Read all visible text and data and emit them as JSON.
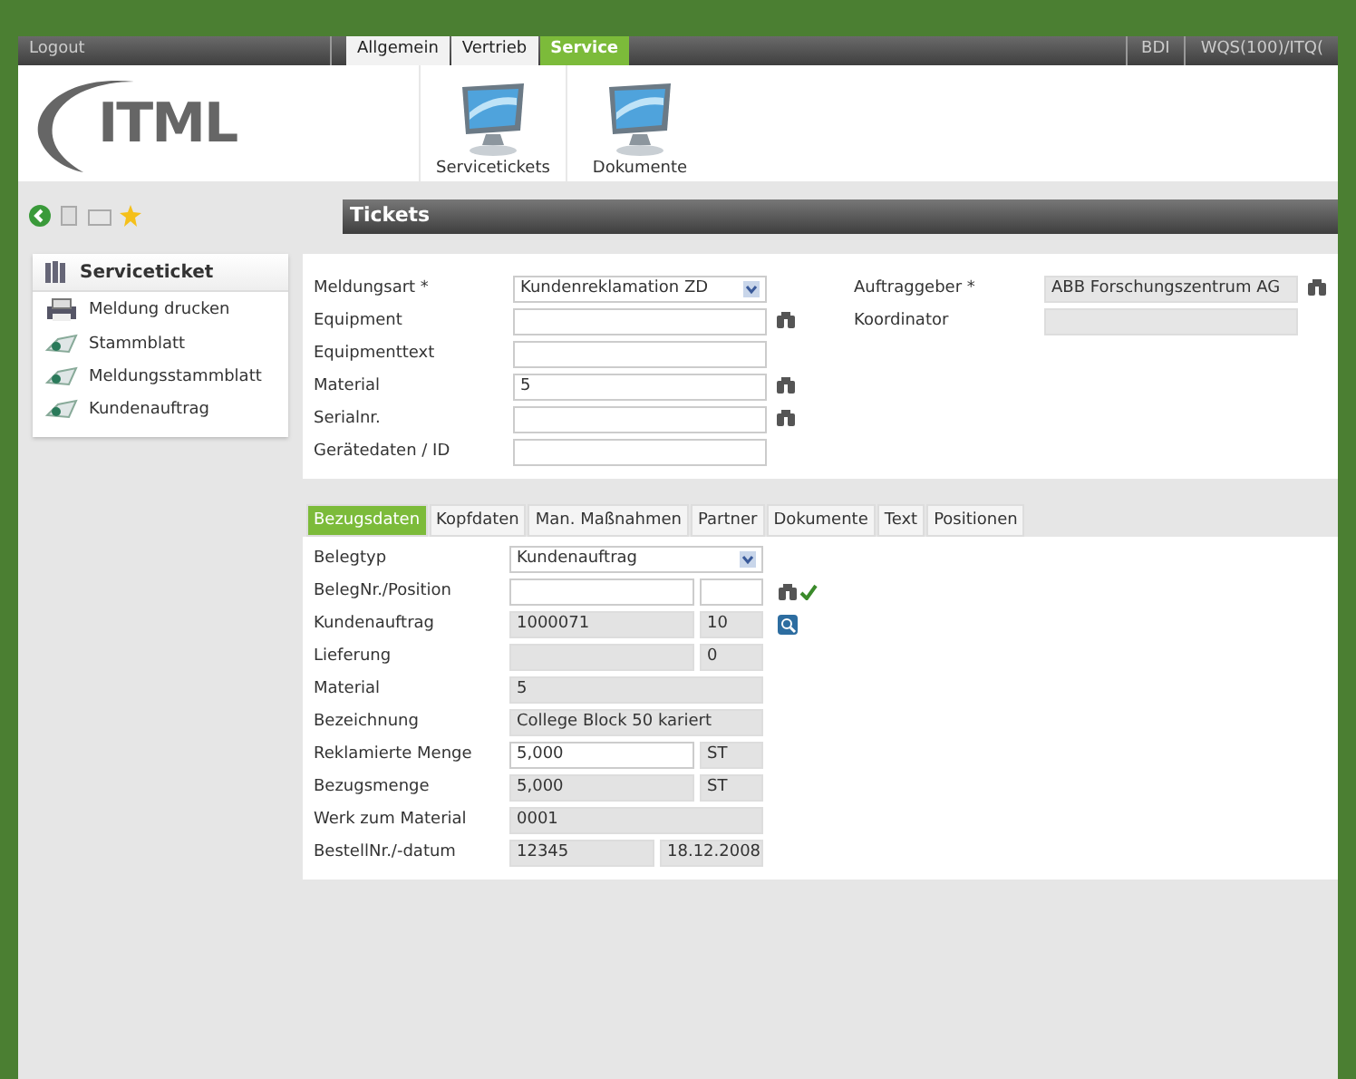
{
  "top_bar": {
    "logout": "Logout",
    "nav_tabs": [
      {
        "label": "Allgemein",
        "selected": false
      },
      {
        "label": "Vertrieb",
        "selected": false
      },
      {
        "label": "Service",
        "selected": true
      }
    ],
    "right_items": [
      "BDI",
      "WQS(100)/ITQ("
    ]
  },
  "logo": {
    "text": "ITML"
  },
  "launchers": [
    {
      "label": "Servicetickets"
    },
    {
      "label": "Dokumente"
    }
  ],
  "panel_title": "Tickets",
  "sidebar": {
    "title": "Serviceticket",
    "items": [
      {
        "label": "Meldung drucken",
        "kind": "print"
      },
      {
        "label": "Stammblatt",
        "kind": "doc"
      },
      {
        "label": "Meldungsstammblatt",
        "kind": "doc"
      },
      {
        "label": "Kundenauftrag",
        "kind": "doc"
      }
    ]
  },
  "form_left": [
    {
      "label": "Meldungsart *",
      "kind": "select",
      "value": "Kundenreklamation ZD",
      "lookup": false
    },
    {
      "label": "Equipment",
      "kind": "input",
      "lookup": true
    },
    {
      "label": "Equipmenttext",
      "kind": "input",
      "lookup": false
    },
    {
      "label": "Material",
      "kind": "input",
      "value": "5",
      "lookup": true
    },
    {
      "label": "Serialnr.",
      "kind": "input",
      "lookup": true
    },
    {
      "label": "Gerätedaten / ID",
      "kind": "input",
      "lookup": false
    }
  ],
  "form_right": [
    {
      "label": "Auftraggeber *",
      "value": "ABB Forschungszentrum AG",
      "disabled": true,
      "lookup": true
    },
    {
      "label": "Koordinator",
      "disabled": true,
      "lookup": false
    }
  ],
  "detail_tabs": [
    {
      "label": "Bezugsdaten",
      "selected": true
    },
    {
      "label": "Kopfdaten",
      "selected": false
    },
    {
      "label": "Man. Maßnahmen",
      "selected": false
    },
    {
      "label": "Partner",
      "selected": false
    },
    {
      "label": "Dokumente",
      "selected": false
    },
    {
      "label": "Text",
      "selected": false
    },
    {
      "label": "Positionen",
      "selected": false
    }
  ],
  "detail_rows": [
    {
      "label": "Belegtyp",
      "kind": "select",
      "fields": [
        {
          "value": "Kundenauftrag",
          "disabled": false
        }
      ]
    },
    {
      "label": "BelegNr./Position",
      "kind": "split",
      "actions": [
        {
          "kind": "lookup"
        },
        {
          "kind": "confirm"
        }
      ],
      "fields": [
        {
          "disabled": false
        },
        {
          "disabled": false
        }
      ]
    },
    {
      "label": "Kundenauftrag",
      "kind": "split",
      "actions": [
        {
          "kind": "search"
        }
      ],
      "fields": [
        {
          "value": "1000071",
          "disabled": true
        },
        {
          "value": "10",
          "disabled": true
        }
      ]
    },
    {
      "label": "Lieferung",
      "kind": "split",
      "fields": [
        {
          "disabled": true
        },
        {
          "value": "0",
          "disabled": true
        }
      ]
    },
    {
      "label": "Material",
      "kind": "single",
      "fields": [
        {
          "value": "5",
          "disabled": true
        }
      ]
    },
    {
      "label": "Bezeichnung",
      "kind": "single",
      "fields": [
        {
          "value": "College Block 50 kariert",
          "disabled": true
        }
      ]
    },
    {
      "label": "Reklamierte Menge",
      "kind": "split",
      "fields": [
        {
          "value": "5,000",
          "disabled": false
        },
        {
          "value": "ST",
          "disabled": true
        }
      ]
    },
    {
      "label": "Bezugsmenge",
      "kind": "split",
      "fields": [
        {
          "value": "5,000",
          "disabled": true
        },
        {
          "value": "ST",
          "disabled": true
        }
      ]
    },
    {
      "label": "Werk zum Material",
      "kind": "single",
      "fields": [
        {
          "value": "0001",
          "disabled": true
        }
      ]
    },
    {
      "label": "BestellNr./-datum",
      "kind": "date",
      "fields": [
        {
          "value": "12345",
          "disabled": true
        },
        {
          "value": "18.12.2008",
          "disabled": true
        }
      ]
    }
  ]
}
